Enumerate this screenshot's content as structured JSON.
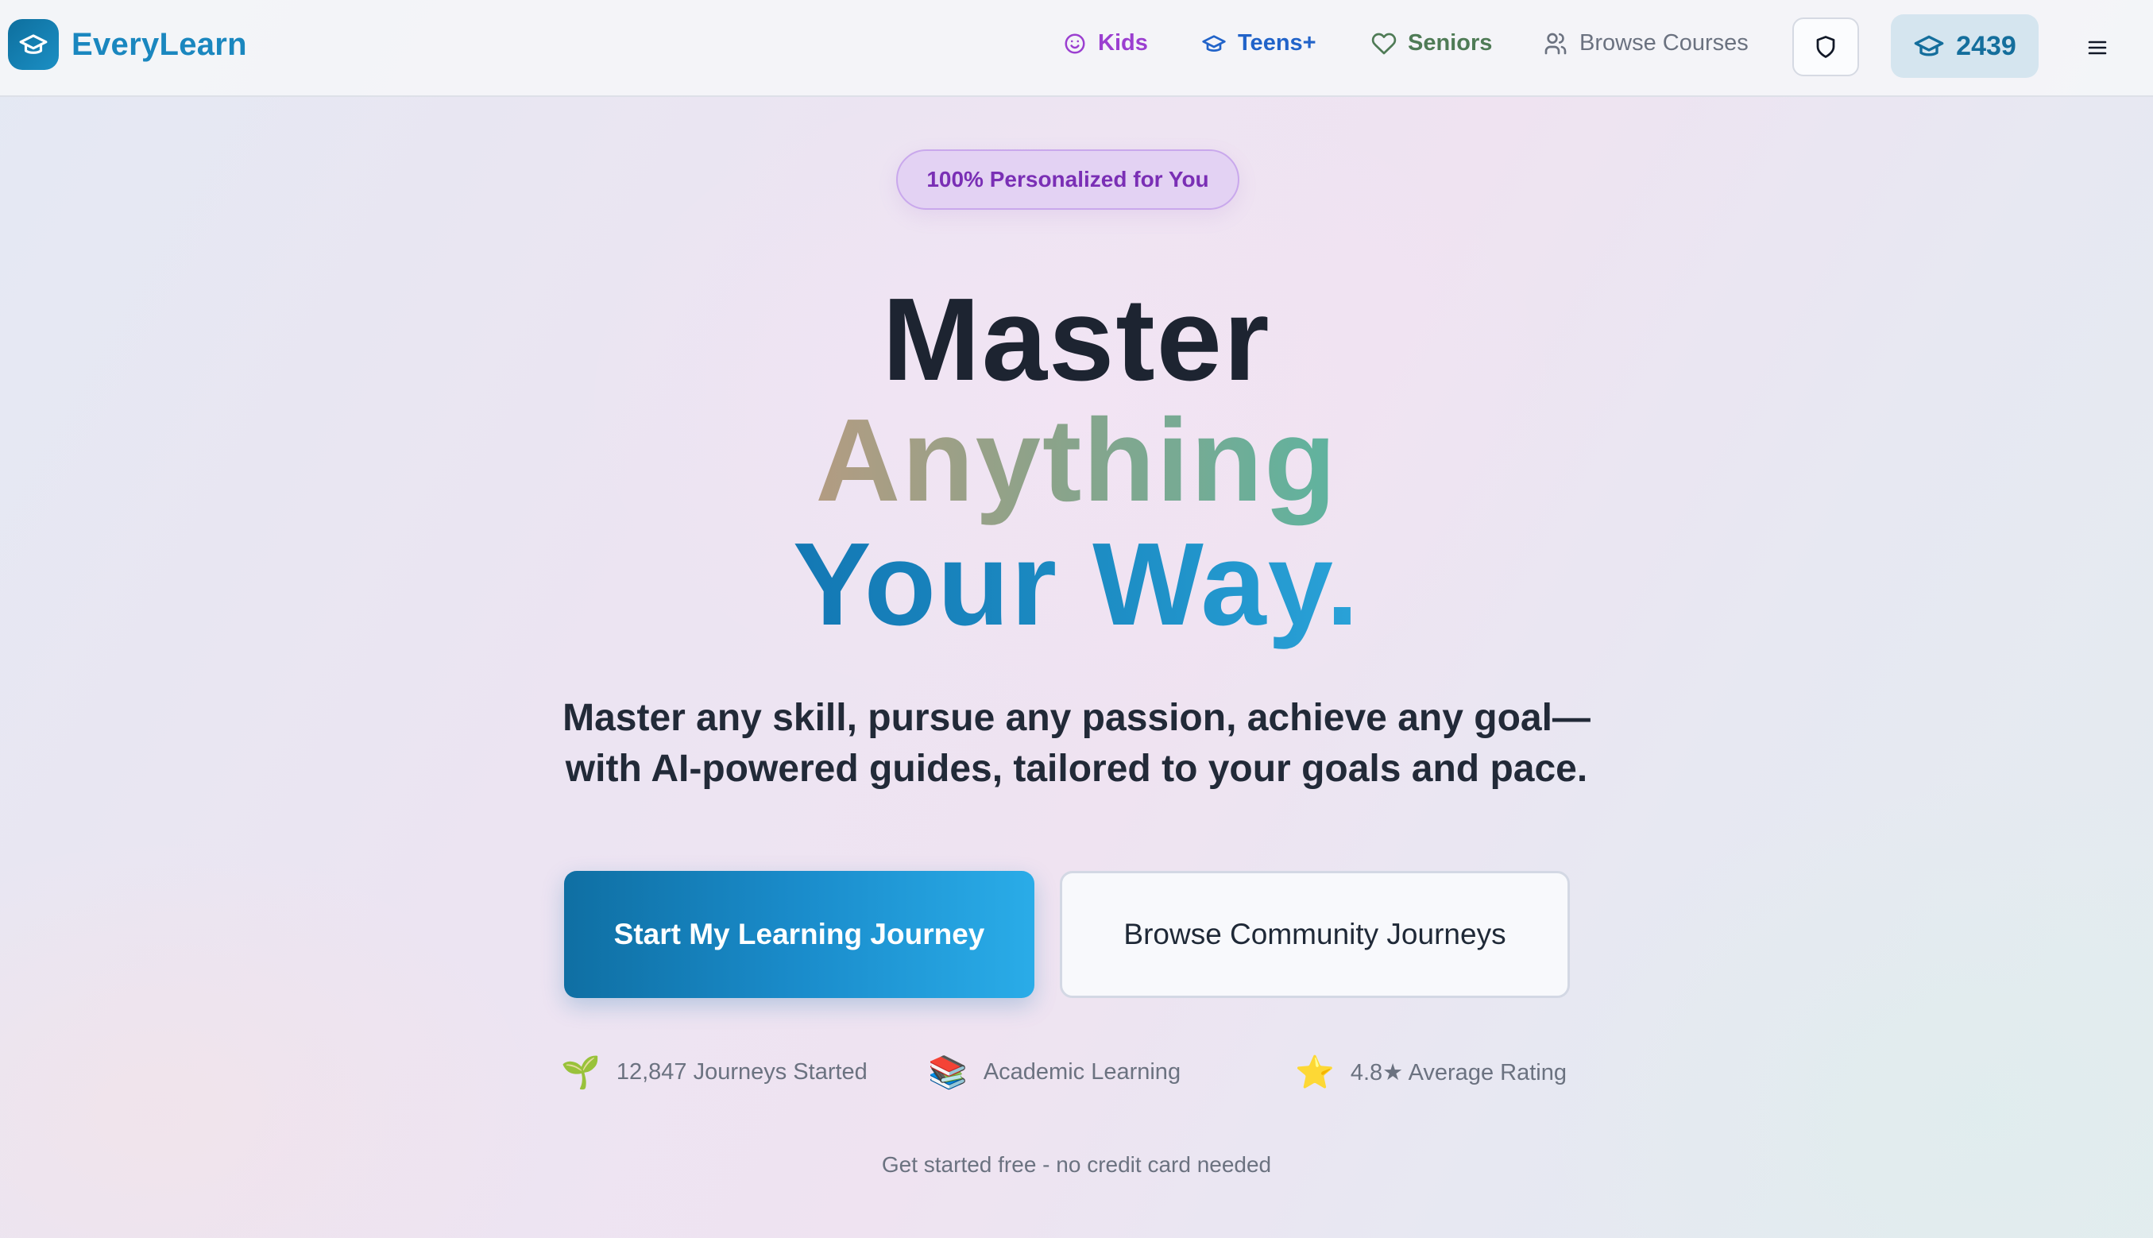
{
  "app": {
    "name": "EveryLearn",
    "logo_icon": "graduation-cap-icon"
  },
  "nav": {
    "kids": "Kids",
    "teens": "Teens+",
    "seniors": "Seniors",
    "browse": "Browse Courses",
    "points": "2439"
  },
  "colors": {
    "brand": "#1a87bf",
    "kids": "#9b3fd0",
    "teens": "#2163c9",
    "seniors": "#4f7b56",
    "badge_bg": "#e3d2f3",
    "primary_button": "#1a8ccb"
  },
  "hero": {
    "badge": "100% Personalized for You",
    "headline_1": "Master",
    "headline_2": "Anything",
    "headline_3": "Your Way.",
    "subtitle_1": "Master any skill, pursue any passion, achieve any goal—",
    "subtitle_2": "with AI-powered guides, tailored to your goals and pace.",
    "primary_cta": "Start My Learning Journey",
    "secondary_cta": "Browse Community Journeys",
    "footnote": "Get started free - no credit card needed"
  },
  "stats": [
    {
      "icon": "🌱",
      "text": "12,847 Journeys Started"
    },
    {
      "icon": "📚",
      "text": "Academic Learning"
    },
    {
      "icon": "⭐",
      "text": "4.8★ Average Rating"
    }
  ]
}
